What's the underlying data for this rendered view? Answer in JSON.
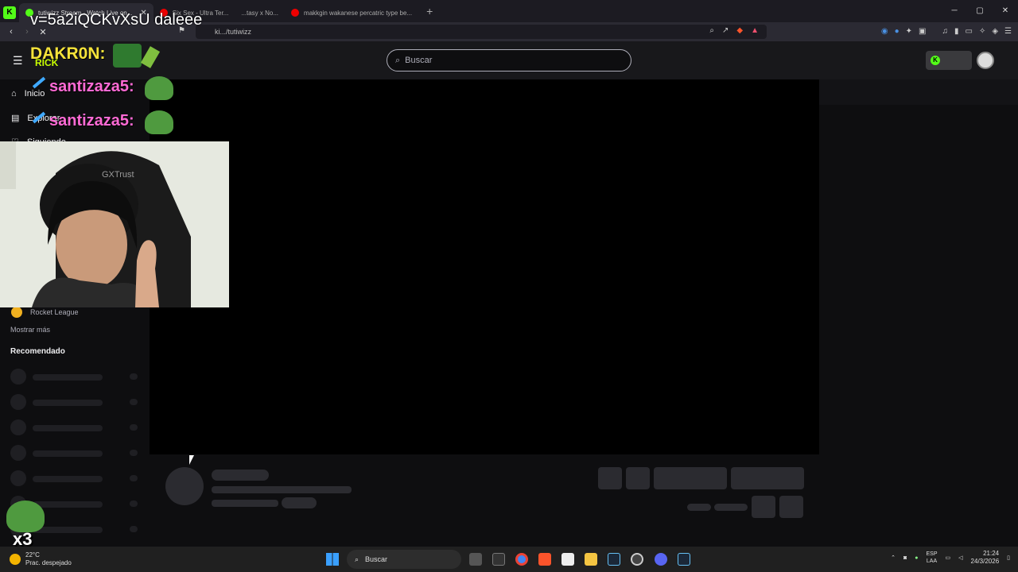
{
  "browser": {
    "tabs": [
      {
        "label": "tutiwizz Stream - Watch Live on...",
        "active": true
      },
      {
        "label": "Six Sex - Ultra Ter...",
        "active": false
      },
      {
        "label": "...tasy x No...",
        "active": false
      },
      {
        "label": "makkgin wakanese percatric type be...",
        "active": false
      }
    ],
    "url": "ki.../tutiwizz",
    "win_min": "─",
    "win_max": "▢",
    "win_close": "✕"
  },
  "overlay": {
    "url_fragment": "v=5a2iQCKvXsU daleee",
    "name1": "DAKR0N:",
    "name1_sub": "RICK",
    "name2": "santizaza5:",
    "name3": "santizaza5:",
    "emote_multiplier": "x3"
  },
  "site": {
    "search_placeholder": "Buscar",
    "sidebar": {
      "items": [
        {
          "label": "Inicio",
          "icon": "home-icon"
        },
        {
          "label": "Explorar",
          "icon": "explore-icon"
        },
        {
          "label": "Siguiendo",
          "icon": "heart-icon"
        }
      ],
      "last_category": "Rocket League",
      "show_more": "Mostrar más",
      "recommended_header": "Recomendado"
    }
  },
  "taskbar": {
    "weather_temp": "22°C",
    "weather_desc": "Prac. despejado",
    "search_label": "Buscar",
    "lang_top": "ESP",
    "lang_bottom": "LAA",
    "time": "21:24",
    "date": "24/3/2026"
  },
  "colors": {
    "kick_green": "#53fc18",
    "bg": "#0e0e10",
    "panel": "#18181b"
  }
}
